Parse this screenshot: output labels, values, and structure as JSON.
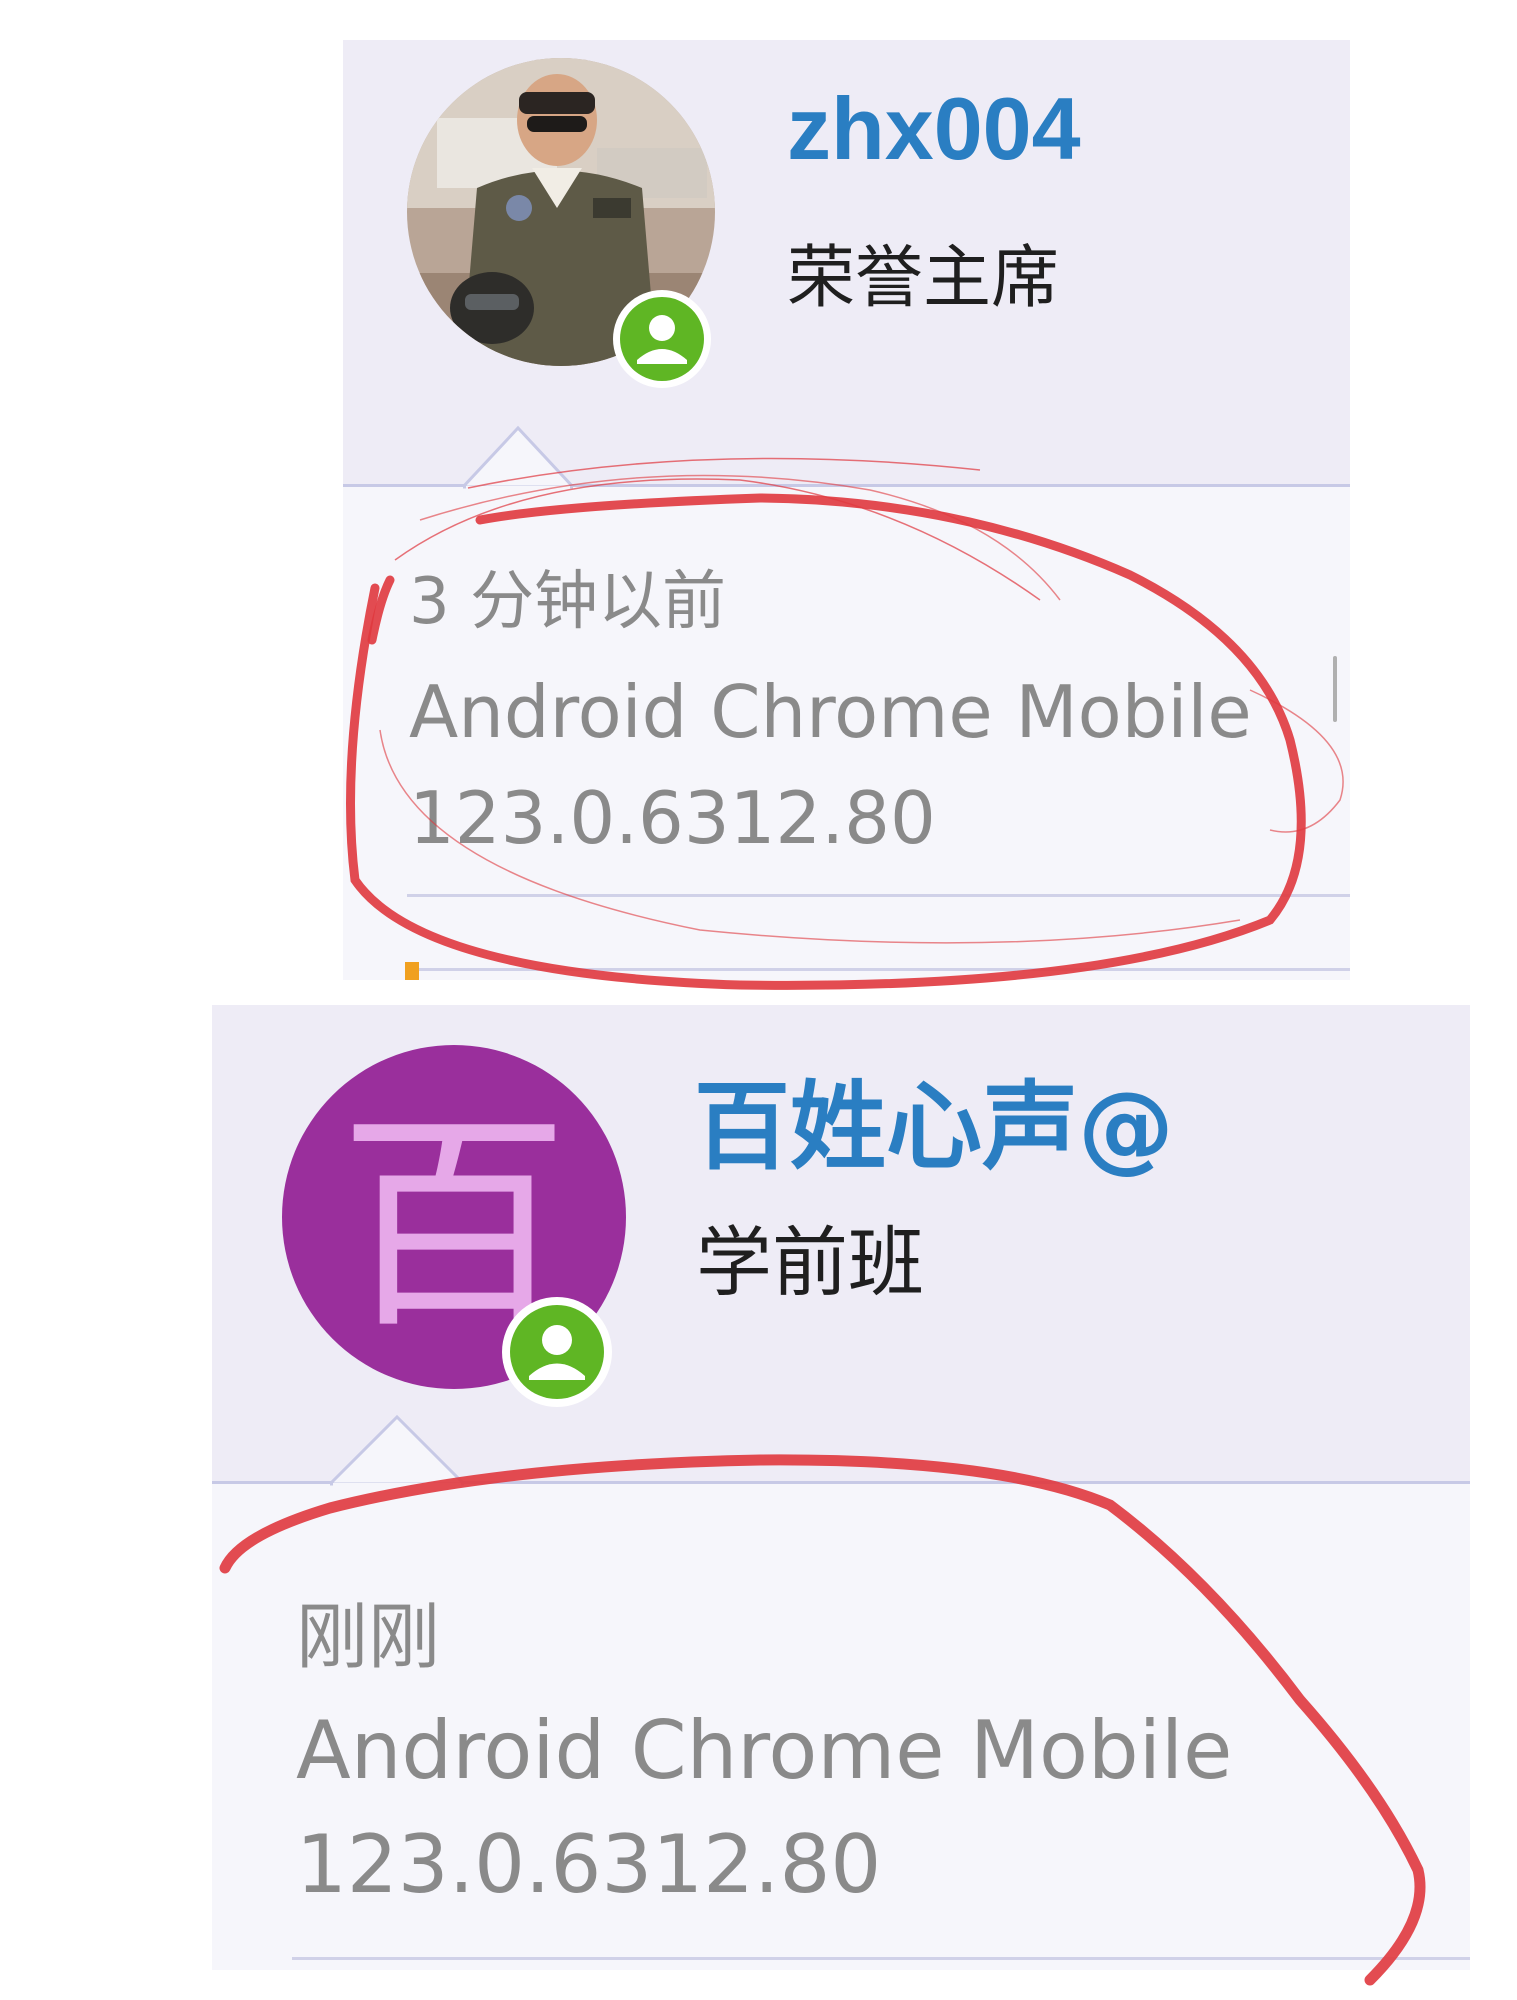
{
  "posts": [
    {
      "username": "zhx004",
      "rank": "荣誉主席",
      "time": "3 分钟以前",
      "browser": "Android Chrome Mobile",
      "version": "123.0.6312.80",
      "avatar": {
        "type": "photo",
        "icon": "pilot-photo-avatar"
      },
      "status_icon": "user-online-icon"
    },
    {
      "username": "百姓心声@",
      "rank": "学前班",
      "time": "刚刚",
      "browser": "Android Chrome Mobile",
      "version": "123.0.6312.80",
      "avatar": {
        "type": "letter",
        "letter": "百",
        "background": "#9a2f9c",
        "letter_color": "#e6a8e8"
      },
      "status_icon": "user-online-icon"
    }
  ],
  "colors": {
    "username": "#2a7ec2",
    "header_bg": "#eeecf6",
    "body_bg": "#f6f6fb",
    "meta_text": "#8a8a8a",
    "status_green": "#5fb624",
    "annotation_red": "#e0383e"
  }
}
